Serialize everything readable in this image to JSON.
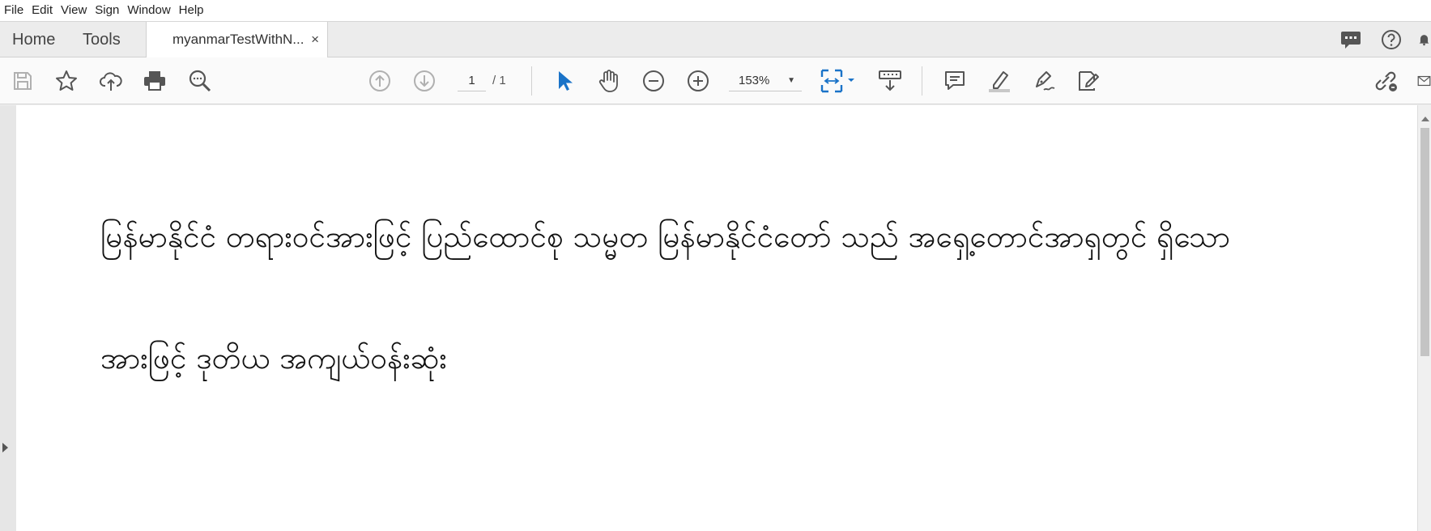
{
  "menu": {
    "items": [
      "File",
      "Edit",
      "View",
      "Sign",
      "Window",
      "Help"
    ]
  },
  "tabs": {
    "home": "Home",
    "tools": "Tools",
    "document": {
      "title": "myanmarTestWithN...",
      "close": "×"
    }
  },
  "toolbar": {
    "page_current": "1",
    "page_total": "/ 1",
    "zoom": "153%",
    "zoom_caret": "▼"
  },
  "document": {
    "line1": "မြန်မာနိုင်ငံ တရားဝင်အားဖြင့် ပြည်ထောင်စု သမ္မတ မြန်မာနိုင်ငံတော် သည် အရှေ့တောင်အာရှတွင် ရှိသော",
    "line2": "အားဖြင့် ဒုတိယ အကျယ်ဝန်းဆုံး"
  },
  "colors": {
    "accent_blue": "#1a73c8",
    "icon_gray": "#555555",
    "disabled_gray": "#b0b0b0",
    "page_bg": "#ffffff",
    "area_bg": "#e6e6e6"
  },
  "icons": {
    "menu": [],
    "tab_bar": [
      "comment-bubble-icon",
      "help-icon",
      "bell-icon"
    ],
    "toolbar": [
      "save-icon",
      "star-icon",
      "cloud-upload-icon",
      "print-icon",
      "search-zoom-icon",
      "page-up-icon",
      "page-down-icon",
      "select-cursor-icon",
      "hand-icon",
      "zoom-out-icon",
      "zoom-in-icon",
      "fit-page-icon",
      "scroll-mode-icon",
      "comment-icon",
      "highlight-icon",
      "sign-icon",
      "edit-form-icon",
      "share-link-icon",
      "email-icon"
    ]
  }
}
